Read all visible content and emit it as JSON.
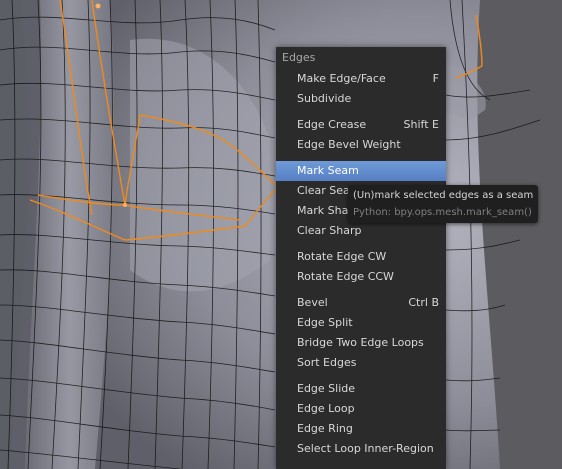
{
  "menu": {
    "title": "Edges",
    "groups": [
      [
        {
          "label": "Make Edge/Face",
          "shortcut": "F"
        },
        {
          "label": "Subdivide",
          "shortcut": ""
        }
      ],
      [
        {
          "label": "Edge Crease",
          "shortcut": "Shift E"
        },
        {
          "label": "Edge Bevel Weight",
          "shortcut": ""
        }
      ],
      [
        {
          "label": "Mark Seam",
          "shortcut": "",
          "active": true
        },
        {
          "label": "Clear Seam",
          "shortcut": ""
        },
        {
          "label": "Mark Sharp",
          "shortcut": ""
        },
        {
          "label": "Clear Sharp",
          "shortcut": ""
        }
      ],
      [
        {
          "label": "Rotate Edge CW",
          "shortcut": ""
        },
        {
          "label": "Rotate Edge CCW",
          "shortcut": ""
        }
      ],
      [
        {
          "label": "Bevel",
          "shortcut": "Ctrl B"
        },
        {
          "label": "Edge Split",
          "shortcut": ""
        },
        {
          "label": "Bridge Two Edge Loops",
          "shortcut": ""
        },
        {
          "label": "Sort Edges",
          "shortcut": ""
        }
      ],
      [
        {
          "label": "Edge Slide",
          "shortcut": ""
        },
        {
          "label": "Edge Loop",
          "shortcut": ""
        },
        {
          "label": "Edge Ring",
          "shortcut": ""
        },
        {
          "label": "Select Loop Inner-Region",
          "shortcut": ""
        }
      ]
    ]
  },
  "tooltip": {
    "description": "(Un)mark selected edges as a seam",
    "python": "Python: bpy.ops.mesh.mark_seam()"
  },
  "colors": {
    "selection": "#f08a1c",
    "highlight": "#5f8bd0",
    "mesh": "#8e8f98",
    "wire": "#111111"
  }
}
